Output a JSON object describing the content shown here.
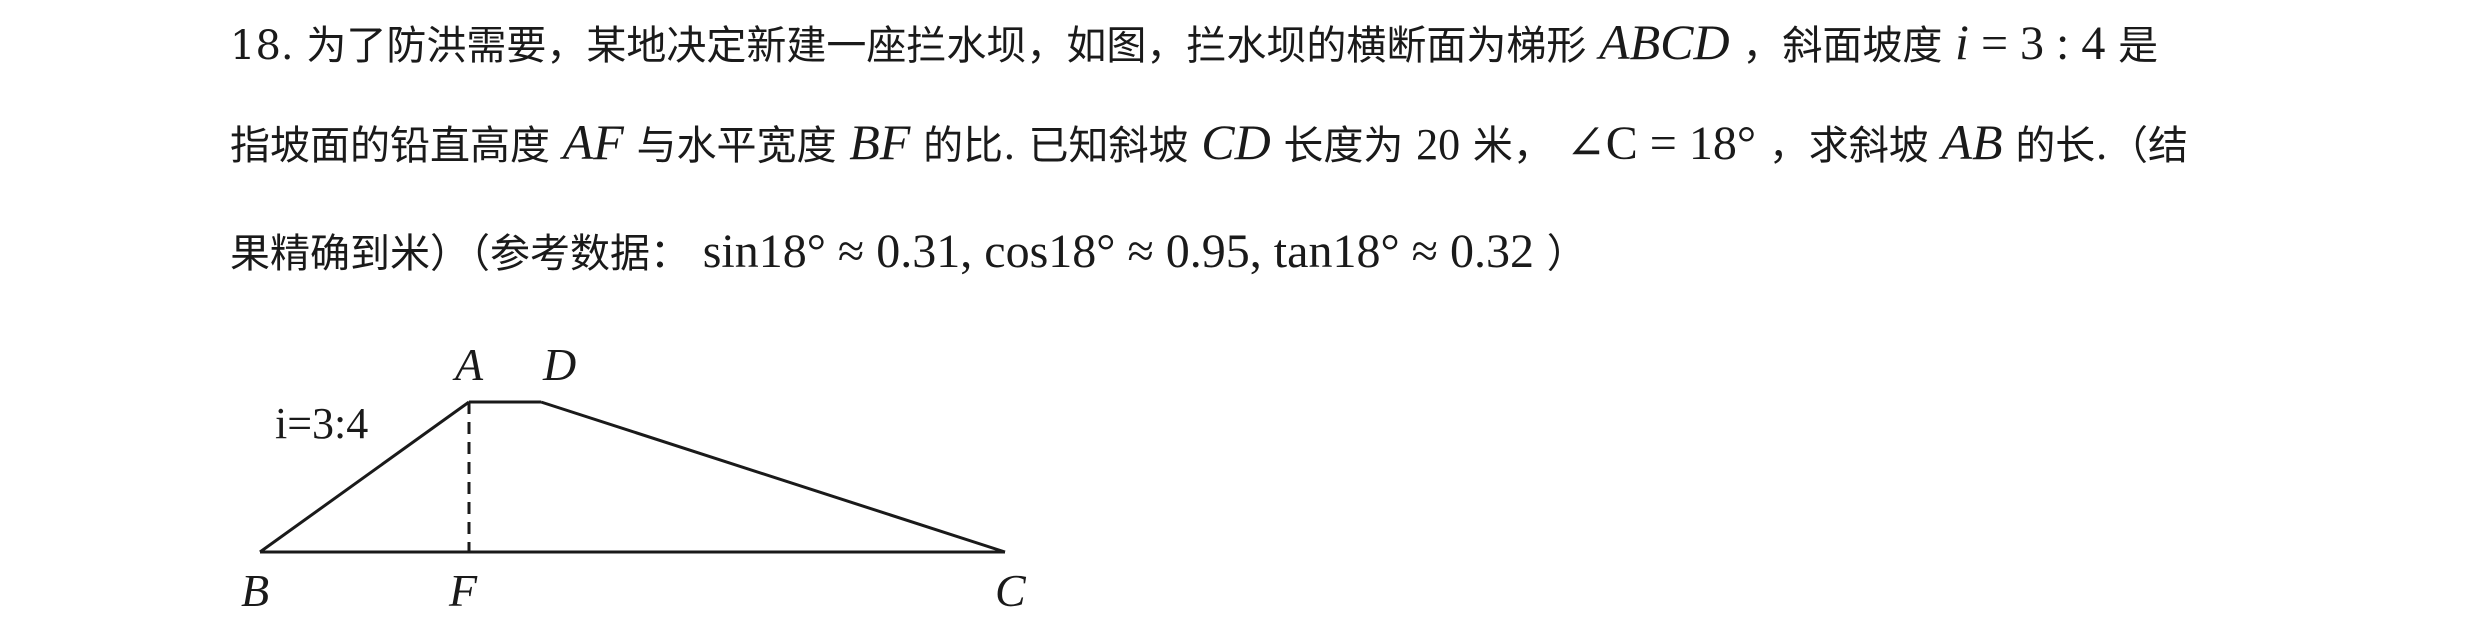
{
  "problem": {
    "number": "18.",
    "line1": {
      "t1": "为了防洪需要，某地决定新建一座拦水坝，如图，拦水坝的横断面为梯形",
      "trap": "ABCD",
      "t2": "，斜面坡度",
      "i": "i",
      "eq": " = 3 : 4",
      "t3": "是"
    },
    "line2": {
      "t1": "指坡面的铅直高度",
      "af": "AF",
      "t2": "与水平宽度",
      "bf": "BF",
      "t3": "的比. 已知斜坡",
      "cd": "CD",
      "t4": "长度为",
      "len": "20",
      "t5": "米，",
      "angle": "∠C = 18°",
      "t6": "，求斜坡",
      "ab": "AB",
      "t7": "的长.（结"
    },
    "line3": {
      "t1": "果精确到米）（参考数据：",
      "ref": "sin18° ≈ 0.31, cos18° ≈ 0.95, tan18° ≈ 0.32",
      "t2": "）"
    }
  },
  "figure": {
    "labels": {
      "A": "A",
      "D": "D",
      "B": "B",
      "F": "F",
      "C": "C"
    },
    "slope_label": "i=3:4"
  }
}
